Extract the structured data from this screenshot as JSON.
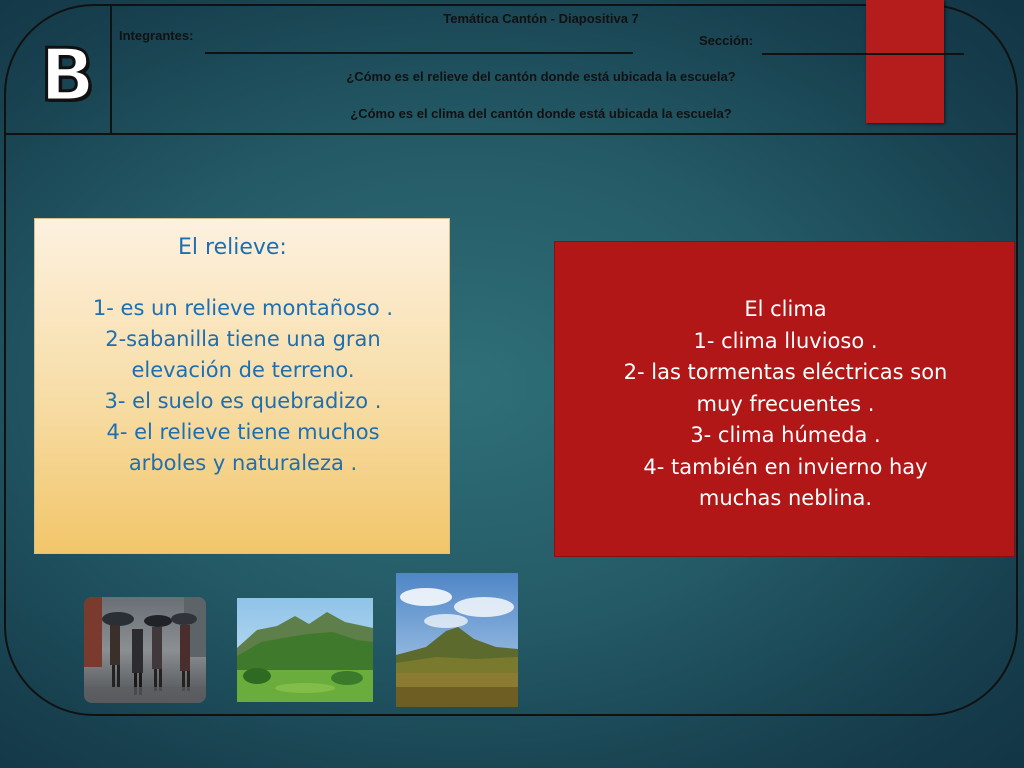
{
  "header": {
    "logo_letter": "B",
    "title": "Temática Cantón - Diapositiva 7",
    "integrantes_label": "Integrantes:",
    "seccion_label": "Sección:",
    "question1": "¿Cómo es el relieve del cantón donde está ubicada la escuela?",
    "question2": "¿Cómo es el clima del cantón donde está ubicada la escuela?"
  },
  "relieve": {
    "title": "El  relieve:",
    "lines": [
      "1- es un relieve montañoso .",
      "2-sabanilla tiene una gran",
      "elevación de terreno.",
      "3- el suelo es quebradizo .",
      "4- el relieve tiene muchos",
      "arboles y naturaleza ."
    ]
  },
  "clima": {
    "lines": [
      "El   clima",
      "1- clima lluvioso .",
      "2- las tormentas eléctricas  son",
      "muy frecuentes .",
      "3- clima húmeda .",
      "4- también  en  invierno  hay",
      "muchas neblina."
    ]
  },
  "photos": [
    {
      "name": "rain-street-photo"
    },
    {
      "name": "green-mountains-photo"
    },
    {
      "name": "hill-landscape-photo"
    }
  ],
  "colors": {
    "red_accent": "#b51d1d",
    "relieve_text": "#1d6fb1"
  }
}
